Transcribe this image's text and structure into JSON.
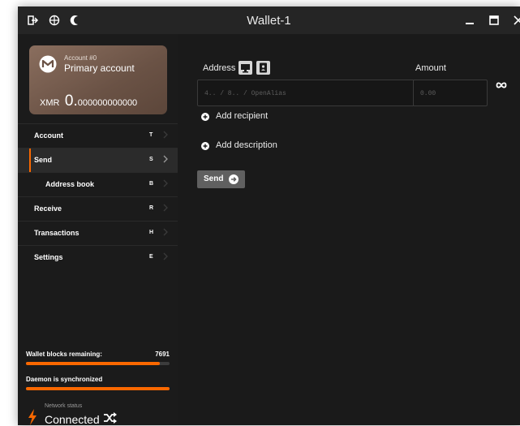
{
  "window": {
    "title": "Wallet-1",
    "icons": [
      "exit-icon",
      "globe-icon",
      "moon-icon"
    ],
    "controls": [
      "minimize-icon",
      "maximize-icon",
      "close-icon"
    ]
  },
  "account_card": {
    "account_number": "Account #0",
    "account_name": "Primary account",
    "currency": "XMR",
    "balance_int": "0.",
    "balance_dec": "000000000000"
  },
  "nav": {
    "items": [
      {
        "label": "Account",
        "key": "T"
      },
      {
        "label": "Send",
        "key": "S"
      },
      {
        "label": "Address book",
        "key": "B"
      },
      {
        "label": "Receive",
        "key": "R"
      },
      {
        "label": "Transactions",
        "key": "H"
      },
      {
        "label": "Settings",
        "key": "E"
      }
    ]
  },
  "status": {
    "blocks_label": "Wallet blocks remaining:",
    "blocks_value": "7691",
    "wallet_sync_fraction": 0.93,
    "daemon_label": "Daemon is synchronized",
    "daemon_sync_fraction": 1.0,
    "network_label": "Network status",
    "network_value": "Connected"
  },
  "form": {
    "address_label": "Address",
    "amount_label": "Amount",
    "address_placeholder": "4.. / 8.. / OpenAlias",
    "amount_placeholder": "0.00",
    "add_recipient": "Add recipient",
    "add_description": "Add description",
    "send_label": "Send"
  },
  "colors": {
    "accent": "#fa6800",
    "background": "#1a1a1a",
    "sidebar": "#1b1b1b"
  }
}
